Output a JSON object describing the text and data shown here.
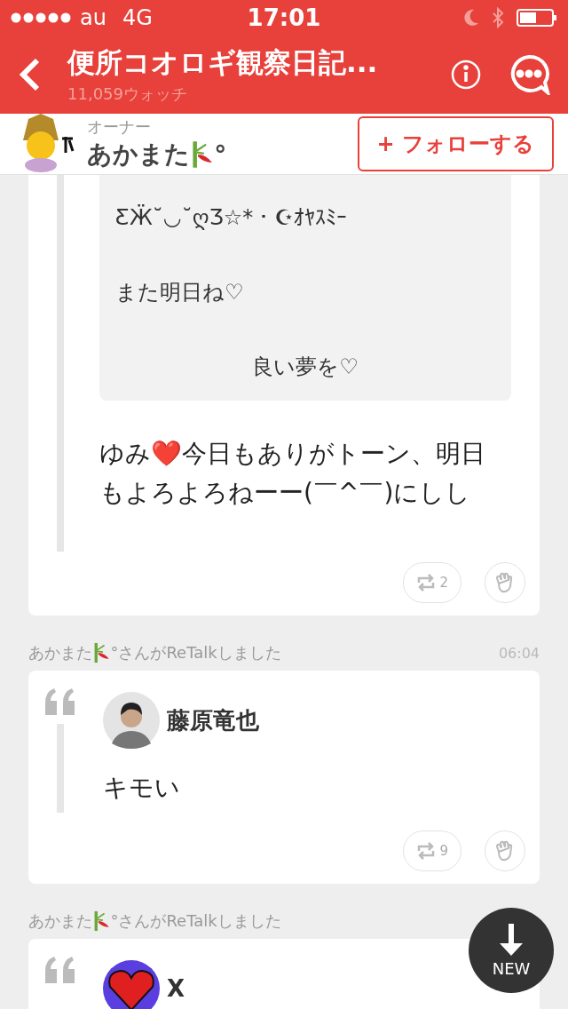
{
  "status_bar": {
    "carrier": "au",
    "network": "4G",
    "time": "17:01"
  },
  "header": {
    "title": "便所コオロギ観察日記...",
    "subtitle": "11,059ウォッチ"
  },
  "owner": {
    "role": "オーナー",
    "name": "あかまた",
    "name_suffix": "°",
    "follow_label": "+ フォローする"
  },
  "posts": [
    {
      "kind": "continued",
      "quoted_lines": [
        {
          "text": "ƸӜ˘◡˘ღƷ☆*・☪ｵﾔｽﾐｰ",
          "centered": false
        },
        {
          "text": "また明日ね♡",
          "centered": false
        },
        {
          "text": "良い夢を♡",
          "centered": true
        }
      ],
      "body": "ゆみ❤️今日もありがトーン、明日もよろよろねーー(￣^￣)にしし",
      "retalk_count": "2"
    },
    {
      "kind": "retalk",
      "retalker": "あかまた",
      "retalk_suffix": "°さんがReTalkしました",
      "time": "06:04",
      "author": "藤原竜也",
      "avatar": {
        "kind": "person"
      },
      "body": "キモい",
      "retalk_count": "9"
    },
    {
      "kind": "retalk",
      "retalker": "あかまた",
      "retalk_suffix": "°さんがReTalkしました",
      "author": "X",
      "avatar": {
        "kind": "heart"
      }
    }
  ],
  "new_button": {
    "label": "NEW"
  }
}
